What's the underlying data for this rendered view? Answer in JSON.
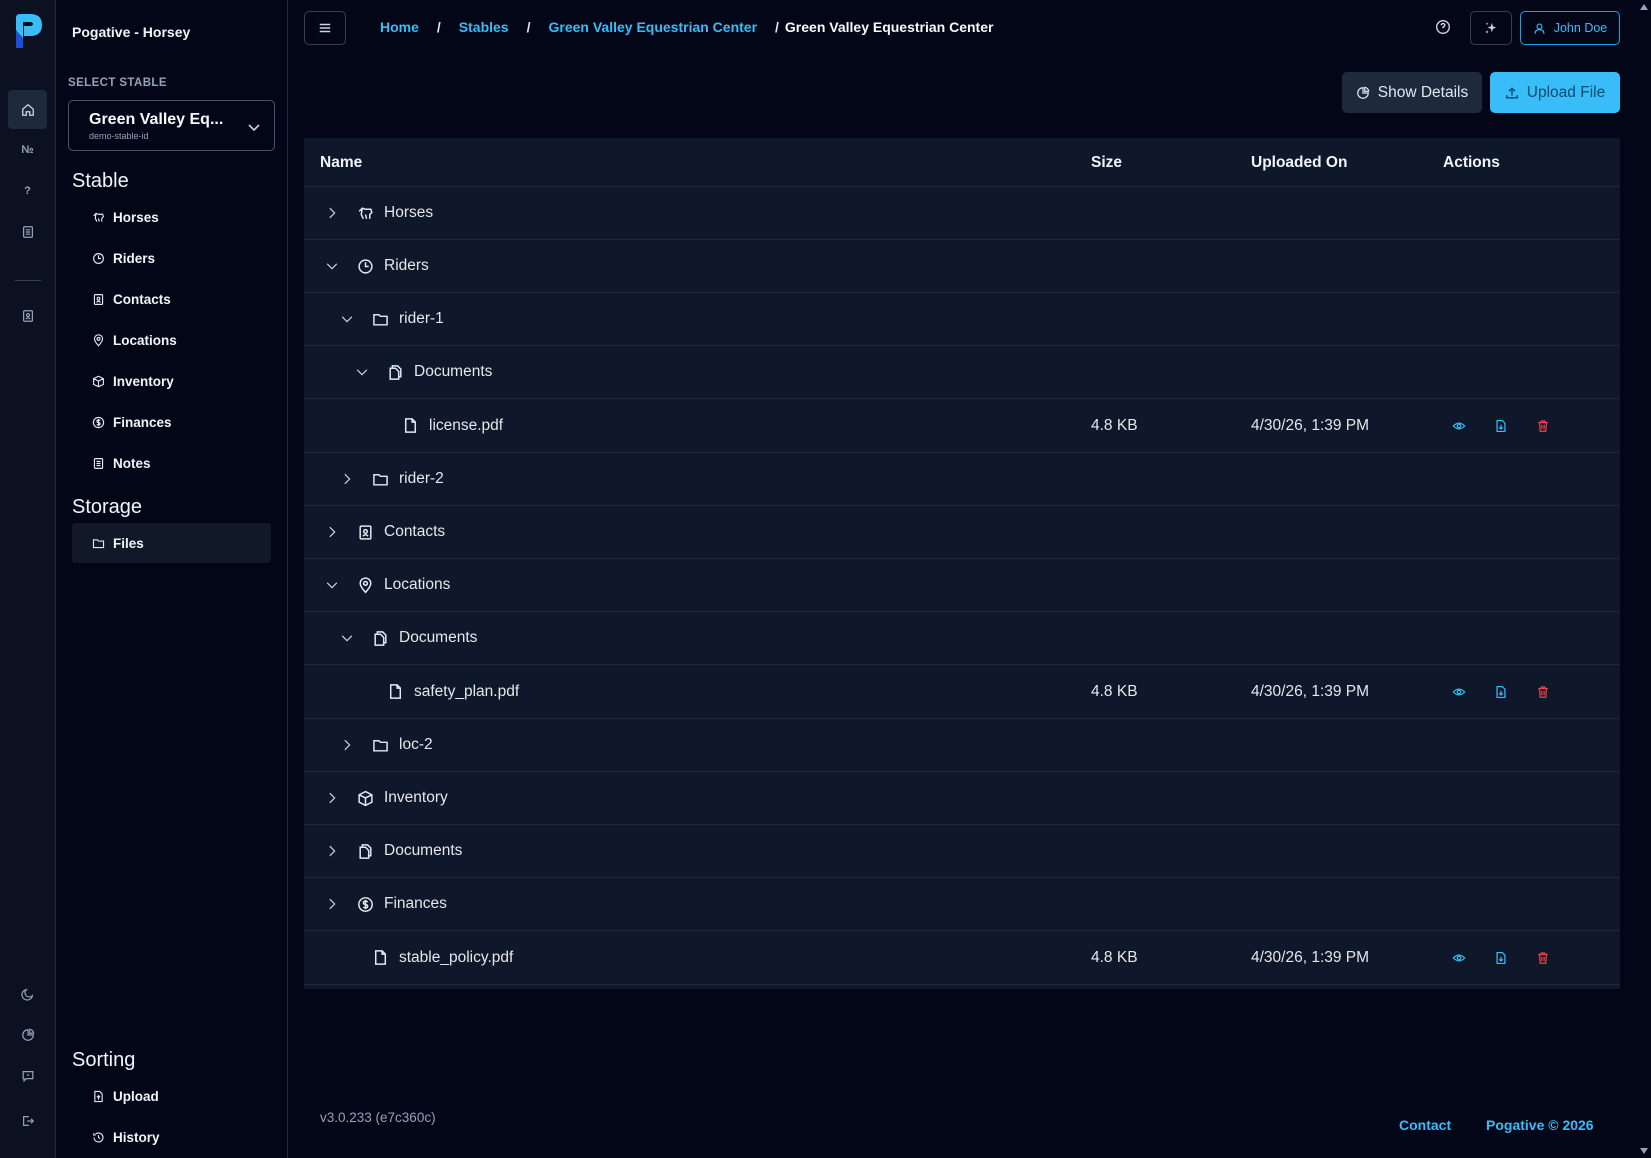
{
  "app": {
    "title": "Pogative - Horsey"
  },
  "rail": {
    "items": [
      {
        "icon": "home-icon"
      },
      {
        "icon": "numero-icon",
        "text": "№"
      },
      {
        "icon": "question-icon",
        "text": "?"
      },
      {
        "icon": "notes-icon"
      },
      {
        "icon": "contact-card-icon"
      }
    ],
    "bottom": [
      {
        "icon": "moon-icon"
      },
      {
        "icon": "pie-chart-icon"
      },
      {
        "icon": "chat-icon"
      },
      {
        "icon": "logout-icon"
      }
    ]
  },
  "sidebar": {
    "select_label": "SELECT STABLE",
    "stable_name": "Green Valley Eq...",
    "stable_id": "demo-stable-id",
    "section_stable": "Stable",
    "stable_items": [
      {
        "label": "Horses",
        "icon": "horse-icon"
      },
      {
        "label": "Riders",
        "icon": "riders-icon"
      },
      {
        "label": "Contacts",
        "icon": "contacts-icon"
      },
      {
        "label": "Locations",
        "icon": "location-pin-icon"
      },
      {
        "label": "Inventory",
        "icon": "box-icon"
      },
      {
        "label": "Finances",
        "icon": "dollar-icon"
      },
      {
        "label": "Notes",
        "icon": "notes-icon"
      }
    ],
    "section_storage": "Storage",
    "storage_items": [
      {
        "label": "Files",
        "icon": "folder-icon",
        "active": true
      }
    ],
    "section_sorting": "Sorting",
    "sorting_items": [
      {
        "label": "Upload",
        "icon": "upload-file-icon"
      },
      {
        "label": "History",
        "icon": "history-icon"
      }
    ]
  },
  "breadcrumb": {
    "items": [
      "Home",
      "Stables",
      "Green Valley Equestrian Center"
    ],
    "current": "Green Valley Equestrian Center",
    "separator": "/"
  },
  "header": {
    "user_name": "John Doe"
  },
  "toolbar": {
    "show_details": "Show Details",
    "upload_file": "Upload File"
  },
  "table": {
    "columns": {
      "name": "Name",
      "size": "Size",
      "uploaded": "Uploaded On",
      "actions": "Actions"
    },
    "rows": [
      {
        "name": "Horses",
        "type": "folder",
        "icon": "horse-icon",
        "depth": 0,
        "expanded": false
      },
      {
        "name": "Riders",
        "type": "folder",
        "icon": "riders-icon",
        "depth": 0,
        "expanded": true
      },
      {
        "name": "rider-1",
        "type": "folder",
        "icon": "folder-icon",
        "depth": 1,
        "expanded": true
      },
      {
        "name": "Documents",
        "type": "folder",
        "icon": "documents-icon",
        "depth": 2,
        "expanded": true
      },
      {
        "name": "license.pdf",
        "type": "file",
        "icon": "file-icon",
        "depth": 3,
        "size": "4.8 KB",
        "uploaded": "4/30/26, 1:39 PM"
      },
      {
        "name": "rider-2",
        "type": "folder",
        "icon": "folder-icon",
        "depth": 1,
        "expanded": false
      },
      {
        "name": "Contacts",
        "type": "folder",
        "icon": "contacts-icon",
        "depth": 0,
        "expanded": false
      },
      {
        "name": "Locations",
        "type": "folder",
        "icon": "location-pin-icon",
        "depth": 0,
        "expanded": true
      },
      {
        "name": "Documents",
        "type": "folder",
        "icon": "documents-icon",
        "depth": 1,
        "expanded": true
      },
      {
        "name": "safety_plan.pdf",
        "type": "file",
        "icon": "file-icon",
        "depth": 2,
        "size": "4.8 KB",
        "uploaded": "4/30/26, 1:39 PM"
      },
      {
        "name": "loc-2",
        "type": "folder",
        "icon": "folder-icon",
        "depth": 1,
        "expanded": false
      },
      {
        "name": "Inventory",
        "type": "folder",
        "icon": "box-icon",
        "depth": 0,
        "expanded": false
      },
      {
        "name": "Documents",
        "type": "folder",
        "icon": "documents-icon",
        "depth": 0,
        "expanded": false
      },
      {
        "name": "Finances",
        "type": "folder",
        "icon": "dollar-icon",
        "depth": 0,
        "expanded": false
      },
      {
        "name": "stable_policy.pdf",
        "type": "file",
        "icon": "file-icon",
        "depth": 1,
        "size": "4.8 KB",
        "uploaded": "4/30/26, 1:39 PM"
      }
    ]
  },
  "footer": {
    "version": "v3.0.233 (e7c360c)",
    "contact": "Contact",
    "copyright": "Pogative © 2026"
  },
  "colors": {
    "background": "#020617",
    "panel": "#0f172a",
    "accent": "#38bdf8",
    "danger": "#ef4444"
  }
}
